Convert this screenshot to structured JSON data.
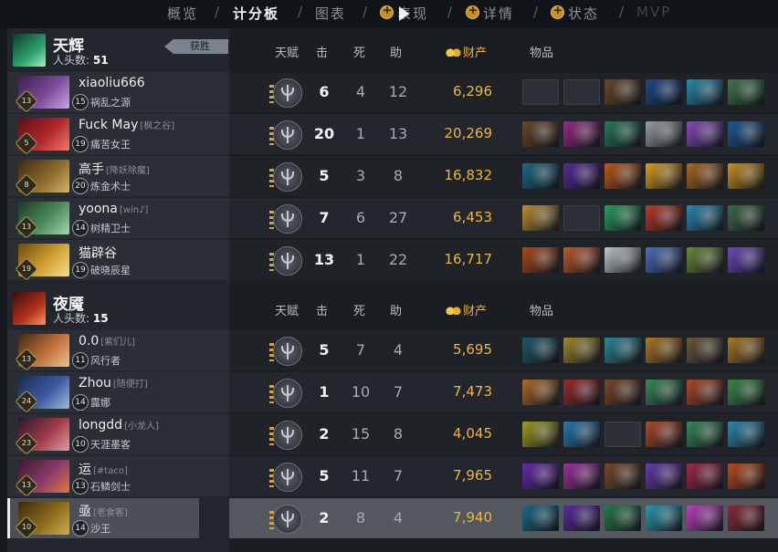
{
  "nav": {
    "tabs": [
      "概览",
      "计分板",
      "图表",
      "表现",
      "详情",
      "状态",
      "MVP"
    ],
    "active_index": 1
  },
  "columns": {
    "talent": "天赋",
    "kills": "击",
    "deaths": "死",
    "assists": "助",
    "networth": "财产",
    "items": "物品"
  },
  "radiant": {
    "name": "天辉",
    "kills_label": "人头数:",
    "kills": "51",
    "win_badge": "获胜",
    "players": [
      {
        "name": "xiaoliu666",
        "tag": "",
        "rank": "15",
        "hero": "祸乱之源",
        "level": "13",
        "k": "6",
        "d": "4",
        "a": "12",
        "nw": "6,296",
        "portrait": [
          "#3b1f4a",
          "#7a4a9a",
          "#c9a6e0"
        ],
        "items": [
          "empty",
          "empty",
          "#6b4a2a",
          "#1d4a8a",
          "#2a8ab0",
          "#3e7a4a"
        ]
      },
      {
        "name": "Fuck May",
        "tag": "[枫之谷]",
        "rank": "19",
        "hero": "痛苦女王",
        "level": "5",
        "k": "20",
        "d": "1",
        "a": "13",
        "nw": "20,269",
        "portrait": [
          "#5a0f14",
          "#b0272b",
          "#f07a6a"
        ],
        "items": [
          "#6b4a2a",
          "#9a2a8a",
          "#2a7a5a",
          "#9aa0a8",
          "#8a4ac0",
          "#1e5a9a"
        ]
      },
      {
        "name": "高手",
        "tag": "[降妖除魔]",
        "rank": "20",
        "hero": "炼金术士",
        "level": "8",
        "k": "5",
        "d": "3",
        "a": "8",
        "nw": "16,832",
        "portrait": [
          "#3a2a10",
          "#8a6a2a",
          "#d6b46a"
        ],
        "items": [
          "#1e6a8a",
          "#5a2aa0",
          "#c05a1a",
          "#e0a020",
          "#b06a20",
          "#d09020"
        ]
      },
      {
        "name": "yoona",
        "tag": "[win♪]",
        "rank": "14",
        "hero": "树精卫士",
        "level": "13",
        "k": "7",
        "d": "6",
        "a": "27",
        "nw": "6,453",
        "portrait": [
          "#1e3a2a",
          "#4a8a5a",
          "#a8d6b0"
        ],
        "items": [
          "#c09030",
          "empty",
          "#2aa060",
          "#c03a2a",
          "#2a8ab0",
          "#3e6a4a"
        ]
      },
      {
        "name": "猫辟谷",
        "tag": "",
        "rank": "19",
        "hero": "破晓辰星",
        "level": "19",
        "k": "13",
        "d": "1",
        "a": "22",
        "nw": "16,717",
        "portrait": [
          "#6a4a10",
          "#d0a030",
          "#f6e08a"
        ],
        "items": [
          "#b04a1a",
          "#c05a2a",
          "#c0c8d0",
          "#4a70c0",
          "#6a8a3a",
          "#6a4ac0"
        ]
      }
    ]
  },
  "dire": {
    "name": "夜魇",
    "kills_label": "人头数:",
    "kills": "15",
    "players": [
      {
        "name": "0.0",
        "tag": "[紫们儿]",
        "rank": "11",
        "hero": "风行者",
        "level": "13",
        "k": "5",
        "d": "7",
        "a": "4",
        "nw": "5,695",
        "portrait": [
          "#3a2a14",
          "#c0703a",
          "#f0c090"
        ],
        "items": [
          "#1e5a6a",
          "#a08a2a",
          "#2a8a9a",
          "#b07a20",
          "#6a5a3a",
          "#b07a20"
        ]
      },
      {
        "name": "Zhou",
        "tag": "[随便打]",
        "rank": "14",
        "hero": "露娜",
        "level": "24",
        "k": "1",
        "d": "10",
        "a": "7",
        "nw": "7,473",
        "portrait": [
          "#1a2a4a",
          "#3a5aa0",
          "#a0b8e0"
        ],
        "items": [
          "#b06a2a",
          "#a02a2a",
          "#7a4a2a",
          "#3a8a5a",
          "#b04a2a",
          "#3a8a4a"
        ]
      },
      {
        "name": "longdd",
        "tag": "[小龙人]",
        "rank": "10",
        "hero": "天涯墨客",
        "level": "23",
        "k": "2",
        "d": "15",
        "a": "8",
        "nw": "4,045",
        "portrait": [
          "#2a1a2a",
          "#a03a4a",
          "#e0a0a0"
        ],
        "items": [
          "#a0a020",
          "#2a7ab0",
          "empty",
          "#b04a2a",
          "#3a8a5a",
          "#2a8ab0"
        ]
      },
      {
        "name": "运",
        "tag": "[#taco]",
        "rank": "13",
        "hero": "石鳞剑士",
        "level": "13",
        "k": "5",
        "d": "11",
        "a": "7",
        "nw": "7,965",
        "portrait": [
          "#3a1a2a",
          "#8a3a6a",
          "#e07a40"
        ],
        "items": [
          "#6a2ab0",
          "#a030a0",
          "#7a4a2a",
          "#6a3ab0",
          "#a02a4a",
          "#c04a1a"
        ]
      },
      {
        "name": "亟",
        "tag": "[老食客]",
        "rank": "14",
        "hero": "沙王",
        "level": "10",
        "k": "2",
        "d": "8",
        "a": "4",
        "nw": "7,940",
        "portrait": [
          "#3a2a0a",
          "#8a6a1a",
          "#d0b050"
        ],
        "items": [
          "#1e6a8a",
          "#5a2aa0",
          "#2a7a4a",
          "#2a9ab0",
          "#c040c0",
          "#8a2a3a"
        ]
      }
    ]
  }
}
